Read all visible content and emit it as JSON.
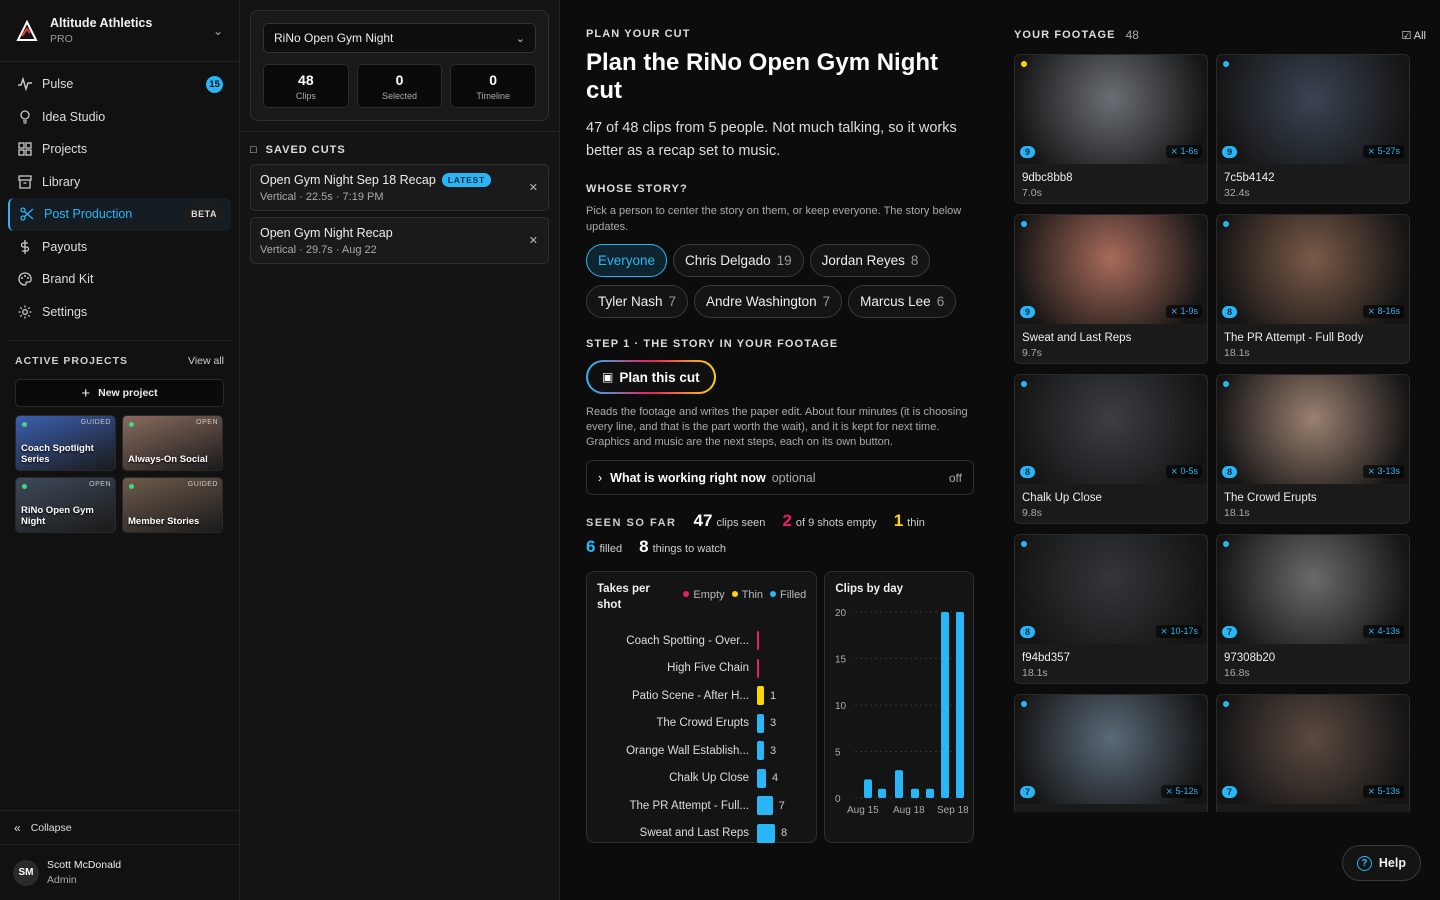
{
  "brand": {
    "name": "Altitude Athletics",
    "plan": "PRO"
  },
  "nav": [
    {
      "label": "Pulse",
      "icon": "pulse-icon",
      "badge": "15"
    },
    {
      "label": "Idea Studio",
      "icon": "lightbulb-icon"
    },
    {
      "label": "Projects",
      "icon": "grid-icon"
    },
    {
      "label": "Library",
      "icon": "archive-icon"
    },
    {
      "label": "Post Production",
      "icon": "scissors-icon",
      "active": true,
      "tag": "BETA"
    },
    {
      "label": "Payouts",
      "icon": "dollar-icon"
    },
    {
      "label": "Brand Kit",
      "icon": "palette-icon"
    },
    {
      "label": "Settings",
      "icon": "gear-icon"
    }
  ],
  "active_projects": {
    "title": "ACTIVE PROJECTS",
    "view_all": "View all",
    "new_label": "New project",
    "items": [
      {
        "title": "Coach Spotlight Series",
        "badge": "GUIDED",
        "color": "#3b5fb0"
      },
      {
        "title": "Always-On Social",
        "badge": "OPEN",
        "color": "#8a6b5e"
      },
      {
        "title": "RiNo Open Gym Night",
        "badge": "OPEN",
        "color": "#3e4a5a"
      },
      {
        "title": "Member Stories",
        "badge": "GUIDED",
        "color": "#6e5b4c"
      }
    ]
  },
  "sidebar_footer": {
    "collapse": "Collapse",
    "user_initials": "SM",
    "user_name": "Scott McDonald",
    "user_role": "Admin"
  },
  "project_panel": {
    "selected": "RiNo Open Gym Night",
    "stats": [
      {
        "value": "48",
        "label": "Clips"
      },
      {
        "value": "0",
        "label": "Selected"
      },
      {
        "value": "0",
        "label": "Timeline"
      }
    ],
    "saved_title": "SAVED CUTS",
    "saved": [
      {
        "title": "Open Gym Night Sep 18 Recap",
        "badge": "LATEST",
        "meta": "Vertical · 22.5s · 7:19 PM"
      },
      {
        "title": "Open Gym Night Recap",
        "meta": "Vertical · 29.7s · Aug 22"
      }
    ]
  },
  "main": {
    "eyebrow": "PLAN YOUR CUT",
    "title": "Plan the RiNo Open Gym Night cut",
    "lead": "47 of 48 clips from 5 people. Not much talking, so it works better as a recap set to music.",
    "whose_title": "WHOSE STORY?",
    "whose_desc": "Pick a person to center the story on them, or keep everyone. The story below updates.",
    "people": [
      {
        "name": "Everyone",
        "count": "",
        "active": true
      },
      {
        "name": "Chris Delgado",
        "count": "19"
      },
      {
        "name": "Jordan Reyes",
        "count": "8"
      },
      {
        "name": "Tyler Nash",
        "count": "7"
      },
      {
        "name": "Andre Washington",
        "count": "7"
      },
      {
        "name": "Marcus Lee",
        "count": "6"
      }
    ],
    "step_title": "STEP 1 · THE STORY IN YOUR FOOTAGE",
    "plan_button": "Plan this cut",
    "step_desc": "Reads the footage and writes the paper edit. About four minutes (it is choosing every line, and that is the part worth the wait), and it is kept for next time. Graphics and music are the next steps, each on its own button.",
    "accordion": {
      "label": "What is working right now",
      "optional": "optional",
      "state": "off"
    },
    "seen": {
      "label": "SEEN SO FAR",
      "clips": "47",
      "clips_label": "clips seen",
      "empty": "2",
      "empty_label": "of 9 shots empty",
      "thin": "1",
      "thin_label": "thin",
      "filled": "6",
      "filled_label": "filled",
      "watch": "8",
      "watch_label": "things to watch"
    }
  },
  "chart_data": [
    {
      "type": "bar",
      "title": "Takes per shot",
      "orientation": "horizontal",
      "legend": [
        "Empty",
        "Thin",
        "Filled"
      ],
      "legend_colors": {
        "Empty": "#e91e63",
        "Thin": "#ffd600",
        "Filled": "#29b6f6"
      },
      "categories": [
        "Coach Spotting - Over...",
        "High Five Chain",
        "Patio Scene - After H...",
        "The Crowd Erupts",
        "Orange Wall Establish...",
        "Chalk Up Close",
        "The PR Attempt - Full...",
        "Sweat and Last Reps"
      ],
      "values": [
        0,
        0,
        1,
        3,
        3,
        4,
        7,
        8
      ],
      "status": [
        "Empty",
        "Empty",
        "Thin",
        "Filled",
        "Filled",
        "Filled",
        "Filled",
        "Filled"
      ]
    },
    {
      "type": "bar",
      "title": "Clips by day",
      "x_ticks": [
        "Aug 15",
        "Aug 18",
        "Sep 18"
      ],
      "y_ticks": [
        "0",
        "5",
        "10",
        "15",
        "20"
      ],
      "ylim": [
        0,
        20
      ],
      "values": [
        2,
        1,
        3,
        1,
        1,
        20,
        20
      ],
      "grid": true,
      "color": "#29b6f6"
    }
  ],
  "footage": {
    "title": "YOUR FOOTAGE",
    "count": "48",
    "select_all": "All",
    "clips": [
      {
        "name": "9dbc8bb8",
        "duration": "7.0s",
        "people": "9",
        "range": "1-6s",
        "dot": "#ffd600",
        "color": "#6a6e74"
      },
      {
        "name": "7c5b4142",
        "duration": "32.4s",
        "people": "9",
        "range": "5-27s",
        "dot": "#29b6f6",
        "color": "#3a4452"
      },
      {
        "name": "Sweat and Last Reps",
        "duration": "9.7s",
        "people": "9",
        "range": "1-9s",
        "dot": "#29b6f6",
        "color": "#a86b5a"
      },
      {
        "name": "The PR Attempt - Full Body",
        "duration": "18.1s",
        "people": "8",
        "range": "8-16s",
        "dot": "#29b6f6",
        "color": "#7a5a48"
      },
      {
        "name": "Chalk Up Close",
        "duration": "9.8s",
        "people": "8",
        "range": "0-5s",
        "dot": "#29b6f6",
        "color": "#3c3e44"
      },
      {
        "name": "The Crowd Erupts",
        "duration": "18.1s",
        "people": "8",
        "range": "3-13s",
        "dot": "#29b6f6",
        "color": "#9a8070"
      },
      {
        "name": "f94bd357",
        "duration": "18.1s",
        "people": "8",
        "range": "10-17s",
        "dot": "#29b6f6",
        "color": "#33363a"
      },
      {
        "name": "97308b20",
        "duration": "16.8s",
        "people": "7",
        "range": "4-13s",
        "dot": "#29b6f6",
        "color": "#6a6a6a"
      },
      {
        "name": "",
        "duration": "",
        "people": "7",
        "range": "5-12s",
        "dot": "#29b6f6",
        "color": "#5a6a78"
      },
      {
        "name": "",
        "duration": "",
        "people": "7",
        "range": "5-13s",
        "dot": "#29b6f6",
        "color": "#5a4a40"
      }
    ]
  },
  "help": "Help"
}
